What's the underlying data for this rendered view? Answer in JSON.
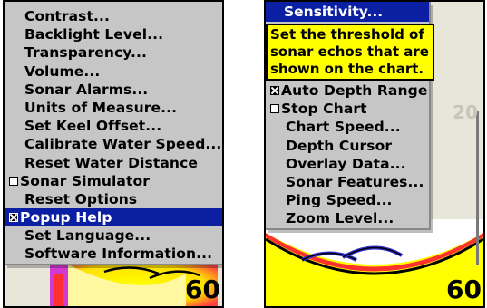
{
  "left_screen": {
    "menu_items": [
      {
        "label": "Contrast...",
        "checkbox": null,
        "selected": false
      },
      {
        "label": "Backlight Level...",
        "checkbox": null,
        "selected": false
      },
      {
        "label": "Transparency...",
        "checkbox": null,
        "selected": false
      },
      {
        "label": "Volume...",
        "checkbox": null,
        "selected": false
      },
      {
        "label": "Sonar Alarms...",
        "checkbox": null,
        "selected": false
      },
      {
        "label": "Units of Measure...",
        "checkbox": null,
        "selected": false
      },
      {
        "label": "Set Keel Offset...",
        "checkbox": null,
        "selected": false
      },
      {
        "label": "Calibrate Water Speed...",
        "checkbox": null,
        "selected": false
      },
      {
        "label": "Reset Water Distance",
        "checkbox": null,
        "selected": false
      },
      {
        "label": "Sonar Simulator",
        "checkbox": false,
        "selected": false
      },
      {
        "label": "Reset Options",
        "checkbox": null,
        "selected": false
      },
      {
        "label": "Popup Help",
        "checkbox": true,
        "selected": true
      },
      {
        "label": "Set Language...",
        "checkbox": null,
        "selected": false
      },
      {
        "label": "Software Information...",
        "checkbox": null,
        "selected": false
      }
    ],
    "depth_max": "60",
    "ghost_top": "0",
    "ghost_side": "5"
  },
  "right_screen": {
    "title": "Sensitivity...",
    "tooltip_lines": [
      "Set the threshold of",
      "sonar echos that are",
      "shown on the chart."
    ],
    "menu_items": [
      {
        "label": "Auto Depth Range",
        "checkbox": true
      },
      {
        "label": "Stop Chart",
        "checkbox": false
      },
      {
        "label": "Chart Speed...",
        "checkbox": null
      },
      {
        "label": "Depth Cursor",
        "checkbox": null
      },
      {
        "label": "Overlay Data...",
        "checkbox": null
      },
      {
        "label": "Sonar Features...",
        "checkbox": null
      },
      {
        "label": "Ping Speed...",
        "checkbox": null
      },
      {
        "label": "Zoom Level...",
        "checkbox": null
      }
    ],
    "depth_max": "60",
    "ghost_mid": "20",
    "ghost_top": "0"
  },
  "colors": {
    "menu_bg": "#c6c6c6",
    "selection": "#0b1fa3",
    "tooltip_bg": "#ffff00",
    "sonar_yellow": "#ffff00",
    "sonar_red": "#ff2020",
    "sonar_blue": "#3030d0"
  }
}
